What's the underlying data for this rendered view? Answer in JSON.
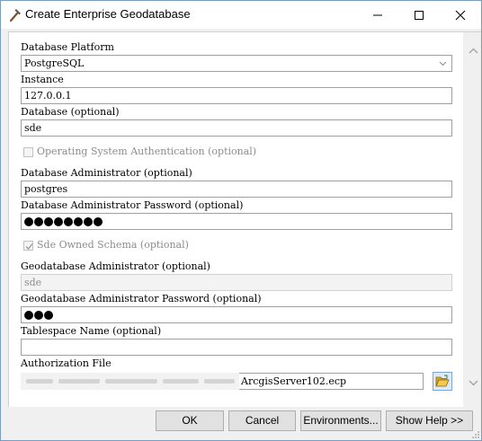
{
  "window": {
    "title": "Create Enterprise Geodatabase",
    "icon": "hammer-icon",
    "controls": [
      "minimize-icon",
      "maximize-icon",
      "close-icon"
    ]
  },
  "form": {
    "database_platform": {
      "label": "Database Platform",
      "value": "PostgreSQL"
    },
    "instance": {
      "label": "Instance",
      "value": "127.0.0.1"
    },
    "database": {
      "label": "Database (optional)",
      "value": "sde"
    },
    "os_auth": {
      "label": "Operating System Authentication (optional)",
      "checked": false,
      "enabled": false
    },
    "db_admin": {
      "label": "Database Administrator (optional)",
      "value": "postgres"
    },
    "db_admin_password": {
      "label": "Database Administrator Password (optional)",
      "masked_length": 8
    },
    "sde_owned_schema": {
      "label": "Sde Owned Schema (optional)",
      "checked": true,
      "enabled": false
    },
    "gdb_admin": {
      "label": "Geodatabase Administrator (optional)",
      "value": "sde",
      "enabled": false
    },
    "gdb_admin_password": {
      "label": "Geodatabase Administrator Password (optional)",
      "masked_length": 3
    },
    "tablespace": {
      "label": "Tablespace Name (optional)",
      "value": ""
    },
    "authorization_file": {
      "label": "Authorization File",
      "value": "ArcgisServer102.ecp",
      "browse_icon": "folder-open-icon"
    }
  },
  "buttons": {
    "ok": "OK",
    "cancel": "Cancel",
    "environments": "Environments...",
    "show_help": "Show Help >>"
  },
  "colors": {
    "window_border": "#7a9cc0",
    "field_border": "#a0a0a0",
    "disabled_text": "#8c8c8c"
  }
}
